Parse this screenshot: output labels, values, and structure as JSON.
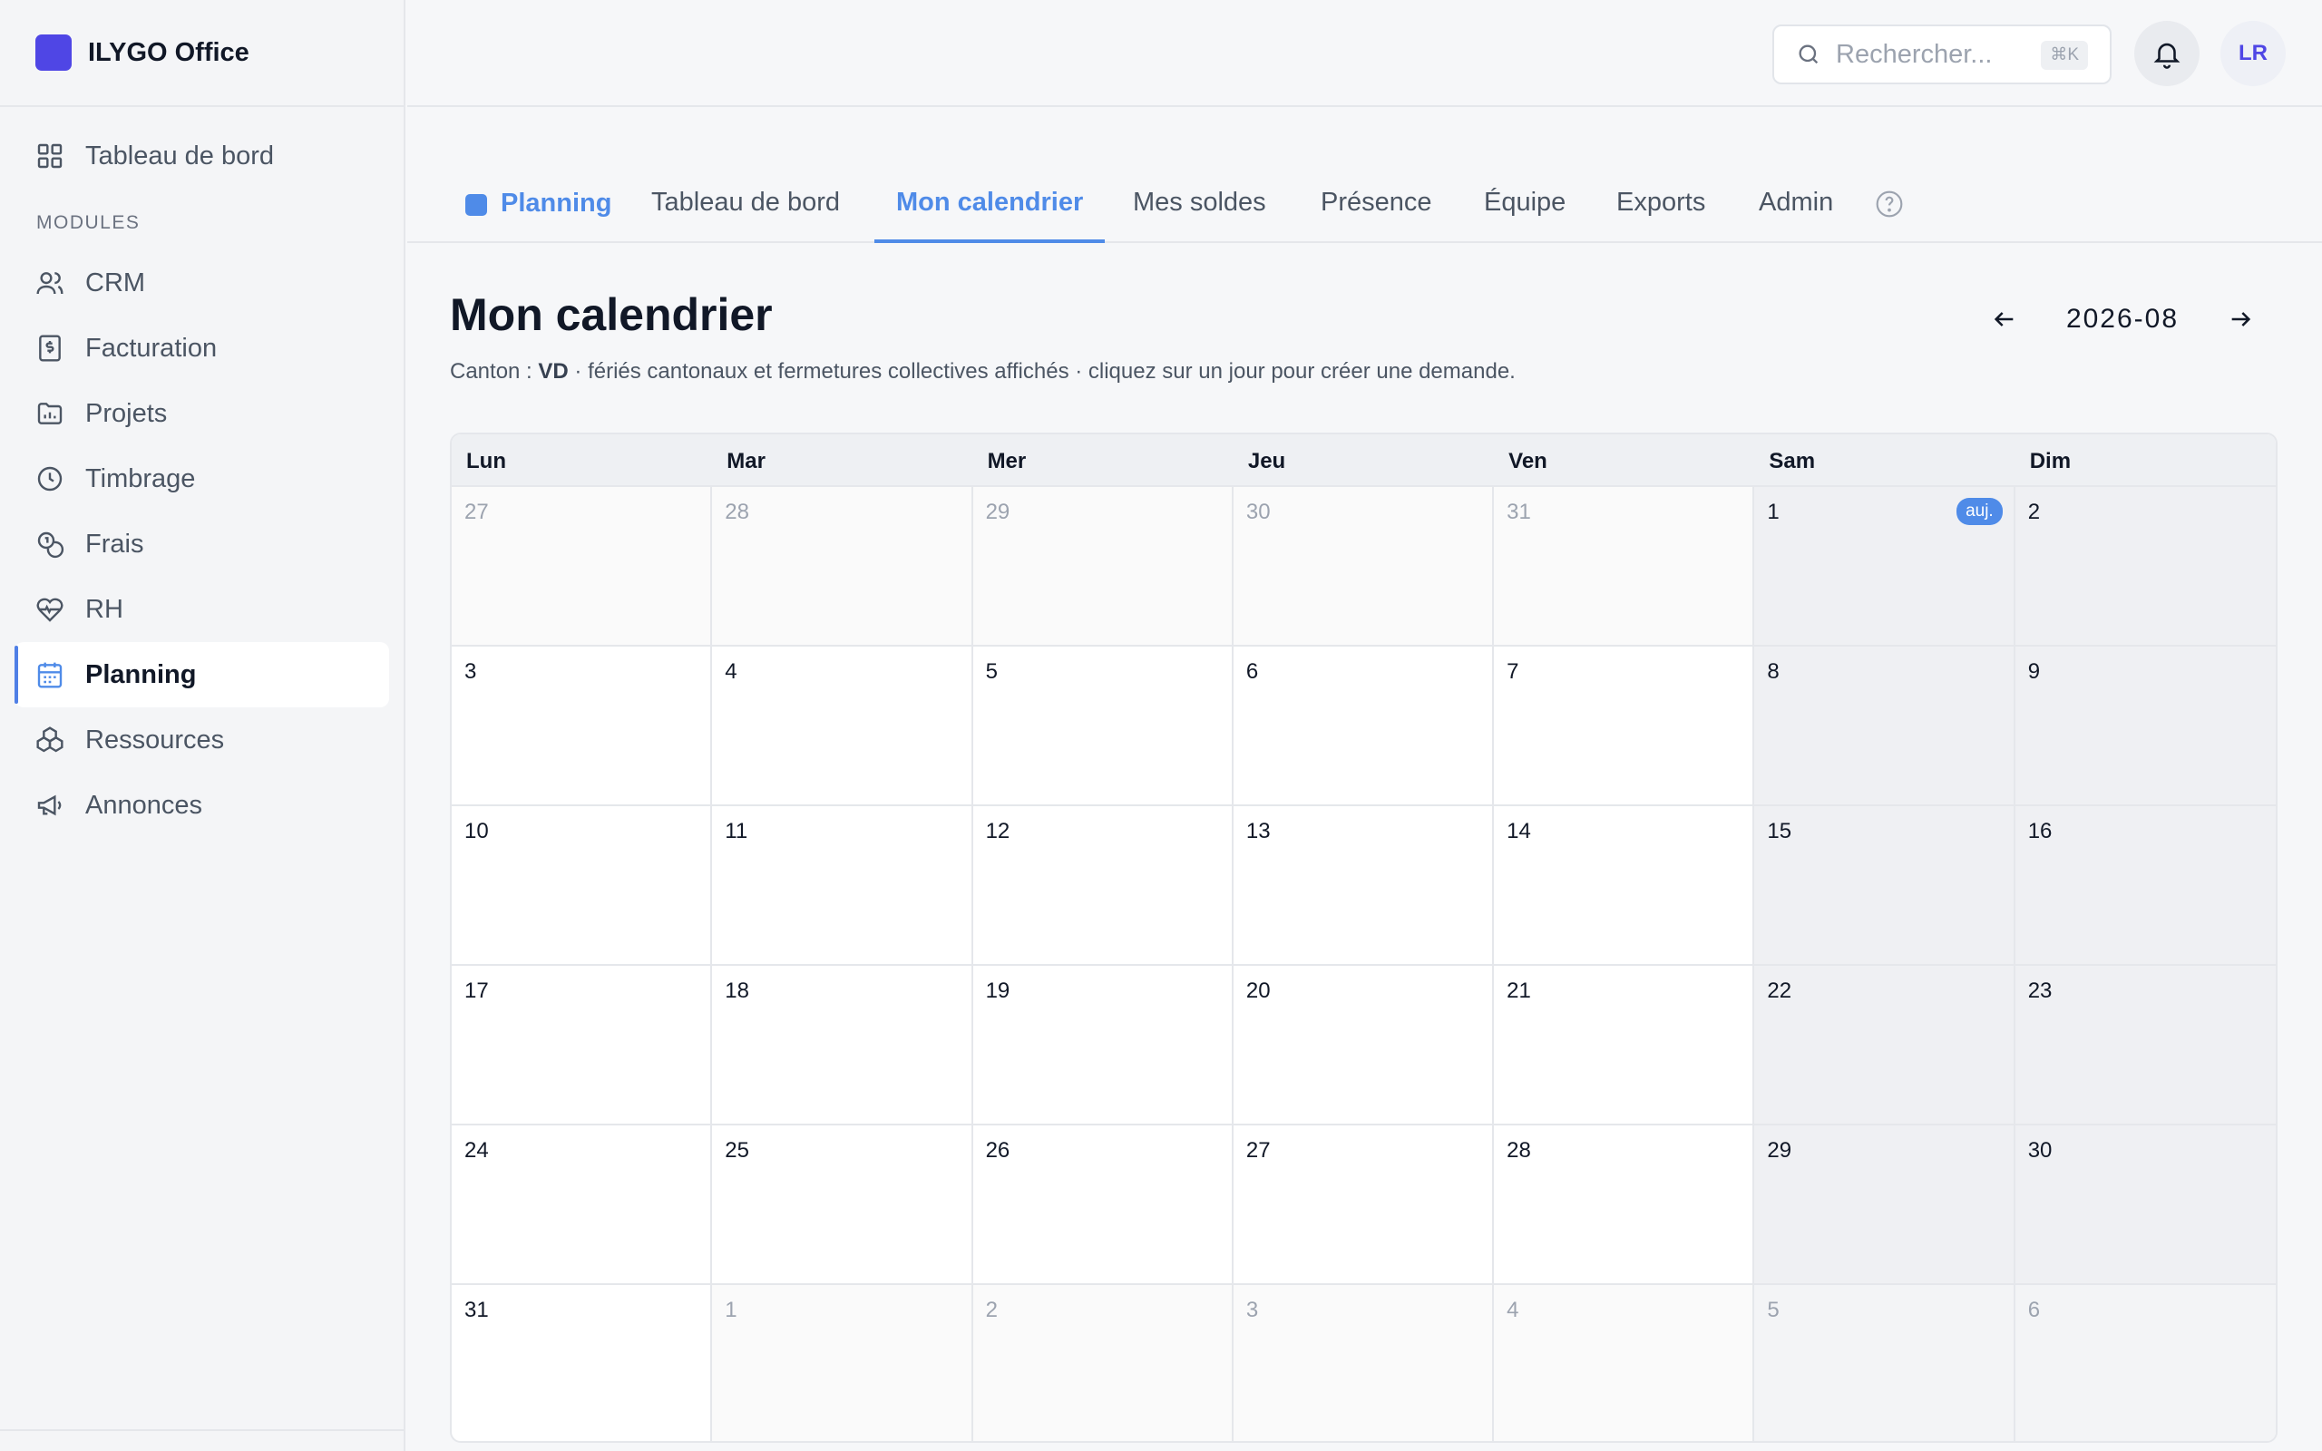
{
  "app": {
    "name": "ILYGO Office",
    "brand_color": "#4f46e5",
    "accent_color": "#4f8be8"
  },
  "sidebar": {
    "top_item": {
      "label": "Tableau de bord",
      "icon": "grid-icon"
    },
    "section_label": "MODULES",
    "items": [
      {
        "label": "CRM",
        "icon": "users-icon"
      },
      {
        "label": "Facturation",
        "icon": "invoice-icon"
      },
      {
        "label": "Projets",
        "icon": "folder-chart-icon"
      },
      {
        "label": "Timbrage",
        "icon": "clock-icon"
      },
      {
        "label": "Frais",
        "icon": "coins-icon"
      },
      {
        "label": "RH",
        "icon": "heart-pulse-icon"
      },
      {
        "label": "Planning",
        "icon": "calendar-icon",
        "active": true
      },
      {
        "label": "Ressources",
        "icon": "boxes-icon"
      },
      {
        "label": "Annonces",
        "icon": "megaphone-icon"
      }
    ]
  },
  "topbar": {
    "search_placeholder": "Rechercher...",
    "search_shortcut": "⌘K",
    "avatar_initials": "LR"
  },
  "tabs": {
    "module": "Planning",
    "items": [
      "Tableau de bord",
      "Mon calendrier",
      "Mes soldes",
      "Présence",
      "Équipe",
      "Exports",
      "Admin"
    ],
    "active": "Mon calendrier"
  },
  "page": {
    "title": "Mon calendrier",
    "subtitle_prefix": "Canton : ",
    "canton": "VD",
    "subtitle_suffix": " · fériés cantonaux et fermetures collectives affichés · cliquez sur un jour pour créer une demande.",
    "month": "2026-08"
  },
  "calendar": {
    "weekdays": [
      "Lun",
      "Mar",
      "Mer",
      "Jeu",
      "Ven",
      "Sam",
      "Dim"
    ],
    "today_badge": "auj.",
    "weeks": [
      [
        "27",
        "28",
        "29",
        "30",
        "31",
        "1",
        "2"
      ],
      [
        "3",
        "4",
        "5",
        "6",
        "7",
        "8",
        "9"
      ],
      [
        "10",
        "11",
        "12",
        "13",
        "14",
        "15",
        "16"
      ],
      [
        "17",
        "18",
        "19",
        "20",
        "21",
        "22",
        "23"
      ],
      [
        "24",
        "25",
        "26",
        "27",
        "28",
        "29",
        "30"
      ],
      [
        "31",
        "1",
        "2",
        "3",
        "4",
        "5",
        "6"
      ]
    ]
  }
}
